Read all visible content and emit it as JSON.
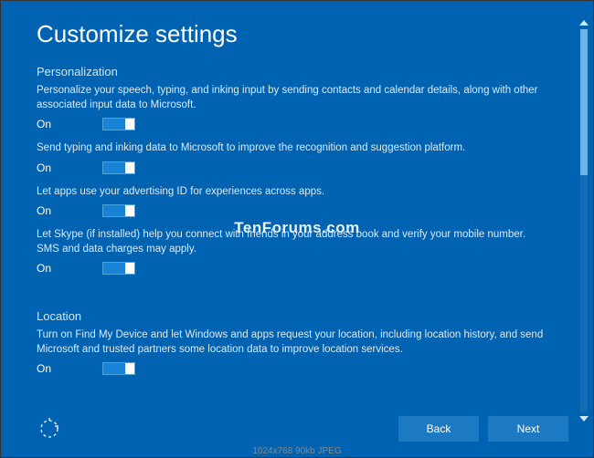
{
  "title": "Customize settings",
  "sections": {
    "personalization": {
      "header": "Personalization",
      "items": [
        {
          "desc": "Personalize your speech, typing, and inking input by sending contacts and calendar details, along with other associated input data to Microsoft.",
          "state": "On"
        },
        {
          "desc": "Send typing and inking data to Microsoft to improve the recognition and suggestion platform.",
          "state": "On"
        },
        {
          "desc": "Let apps use your advertising ID for experiences across apps.",
          "state": "On"
        },
        {
          "desc": "Let Skype (if installed) help you connect with friends in your address book and verify your mobile number. SMS and data charges may apply.",
          "state": "On"
        }
      ]
    },
    "location": {
      "header": "Location",
      "items": [
        {
          "desc": "Turn on Find My Device and let Windows and apps request your location, including location history, and send Microsoft and trusted partners some location data to improve location services.",
          "state": "On"
        }
      ]
    }
  },
  "buttons": {
    "back": "Back",
    "next": "Next"
  },
  "watermark": "TenForums.com",
  "caption": "1024x768   90kb   JPEG"
}
